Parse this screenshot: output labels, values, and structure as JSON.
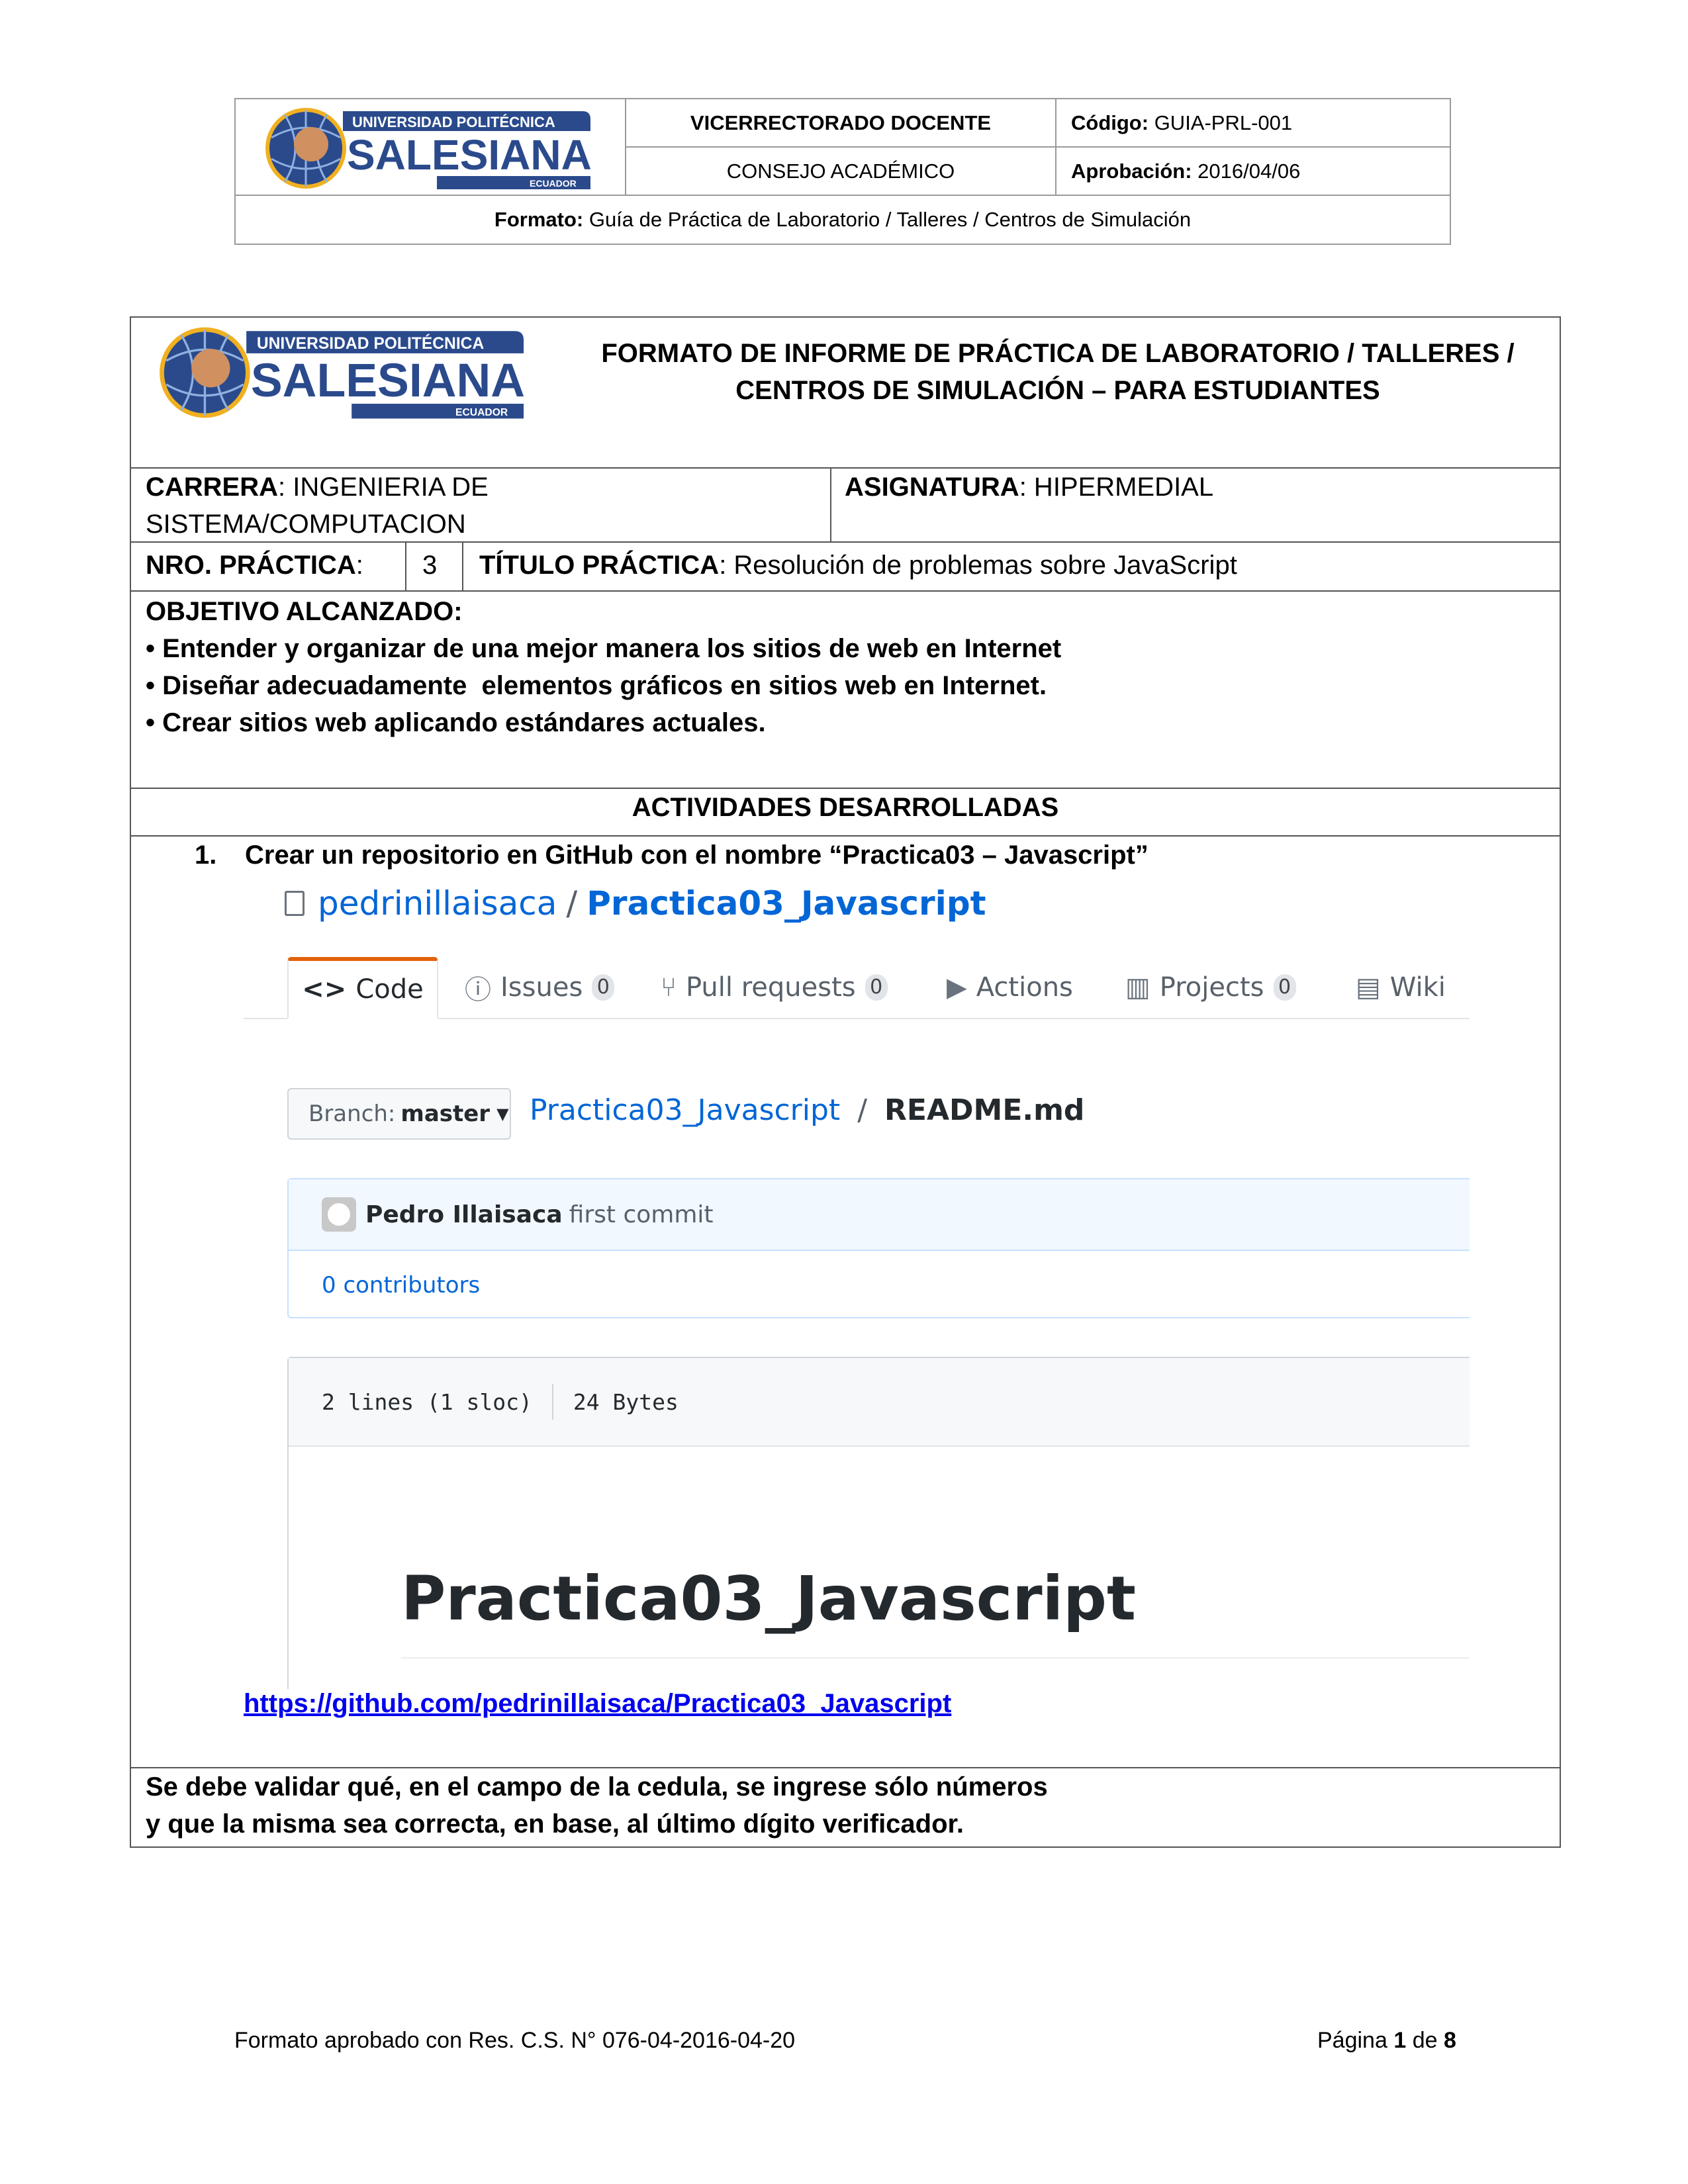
{
  "header": {
    "logo_text": "UNIVERSIDAD POLITÉCNICA SALESIANA ECUADOR",
    "vicerrectorado": "VICERRECTORADO DOCENTE",
    "consejo": "CONSEJO ACADÉMICO",
    "codigo_label": "Código:",
    "codigo_value": " GUIA-PRL-001",
    "aprobacion_label": "Aprobación:",
    "aprobacion_value": " 2016/04/06",
    "formato_label": "Formato:",
    "formato_value": " Guía de Práctica de Laboratorio / Talleres / Centros de Simulación"
  },
  "report": {
    "title_line1": "FORMATO DE INFORME DE PRÁCTICA DE LABORATORIO / TALLERES /",
    "title_line2": "CENTROS DE SIMULACIÓN – PARA ESTUDIANTES",
    "carrera_label": "CARRERA",
    "carrera_value": ": INGENIERIA DE",
    "carrera_value2": "SISTEMA/COMPUTACION",
    "asignatura_label": "ASIGNATURA",
    "asignatura_value": ": HIPERMEDIAL",
    "nro_label": "NRO. PRÁCTICA",
    "nro_colon": ":",
    "nro_value": "3",
    "titulo_label": "TÍTULO PRÁCTICA",
    "titulo_value": ": Resolución de problemas sobre JavaScript",
    "objetivo_heading": "OBJETIVO ALCANZADO:",
    "objetivos": [
      "• Entender y organizar de una mejor manera los sitios de web en Internet",
      "• Diseñar adecuadamente  elementos gráficos en sitios web en Internet.",
      "• Crear sitios web aplicando estándares actuales."
    ],
    "actividades_heading": "ACTIVIDADES DESARROLLADAS",
    "step_number": "1.",
    "step_text": "Crear un repositorio en GitHub con el nombre “Practica03 – Javascript”",
    "link": "https://github.com/pedrinillaisaca/Practica03_Javascript",
    "note_line1": "Se debe validar qué, en el campo de la cedula, se ingrese sólo números",
    "note_line2": "y que la misma sea correcta, en base, al último dígito verificador."
  },
  "github": {
    "owner": "pedrinillaisaca",
    "slash": "/",
    "repo": "Practica03_Javascript",
    "tabs": [
      {
        "label": "Code",
        "icon": "code-icon"
      },
      {
        "label": "Issues",
        "count": "0",
        "icon": "issue-icon"
      },
      {
        "label": "Pull requests",
        "count": "0",
        "icon": "pull-request-icon"
      },
      {
        "label": "Actions",
        "icon": "play-icon"
      },
      {
        "label": "Projects",
        "count": "0",
        "icon": "project-icon"
      },
      {
        "label": "Wiki",
        "icon": "book-icon"
      }
    ],
    "branch_label": "Branch:",
    "branch_name": "master",
    "crumb_repo": "Practica03_Javascript",
    "crumb_sep": "/",
    "crumb_file": "README.md",
    "commit_author": "Pedro Illaisaca",
    "commit_msg": "first commit",
    "contributors": "0 contributors",
    "file_lines": "2 lines (1 sloc)",
    "file_size": "24 Bytes",
    "readme_h1": "Practica03_Javascript",
    "accent_color": "#0366d6",
    "tab_active_color": "#e36209"
  },
  "footer": {
    "left": "Formato aprobado con Res. C.S. N° 076-04-2016-04-20",
    "page_word": "Página ",
    "page_num": "1",
    "of_word": " de ",
    "page_total": "8"
  }
}
